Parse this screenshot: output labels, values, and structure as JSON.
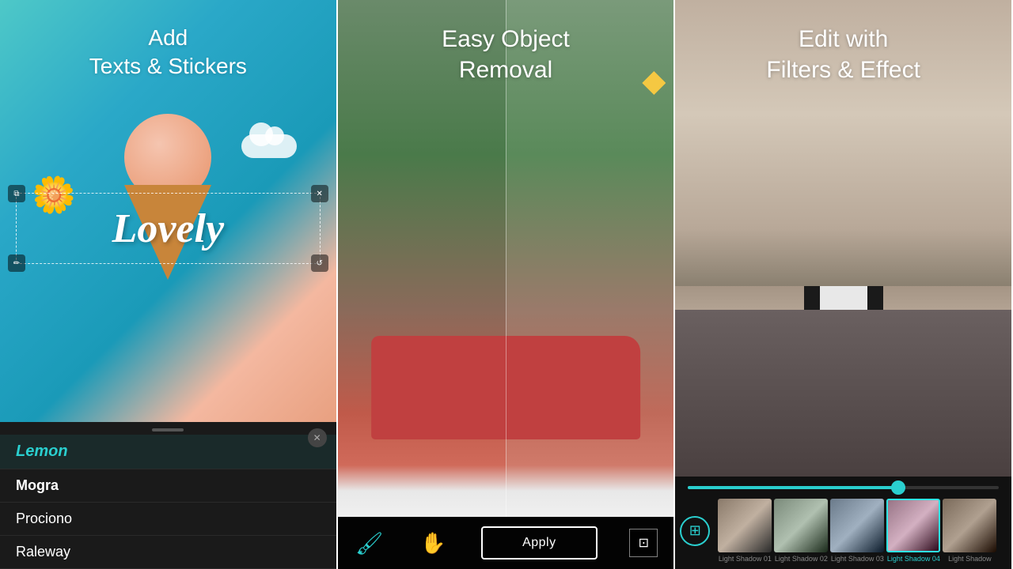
{
  "panel1": {
    "title_line1": "Add",
    "title_line2": "Texts & Stickers",
    "overlay_text": "Lovely",
    "fonts": [
      {
        "name": "Lemon",
        "active": true
      },
      {
        "name": "Mogra",
        "active": false
      },
      {
        "name": "Prociono",
        "active": false
      },
      {
        "name": "Raleway",
        "active": false
      }
    ]
  },
  "panel2": {
    "title_line1": "Easy Object",
    "title_line2": "Removal",
    "apply_button": "Apply"
  },
  "panel3": {
    "title_line1": "Edit with",
    "title_line2": "Filters & Effect",
    "filters": [
      {
        "name": "Light Shadow 01",
        "active": false
      },
      {
        "name": "Light Shadow 02",
        "active": false
      },
      {
        "name": "Light Shadow 03",
        "active": false
      },
      {
        "name": "Light Shadow 04",
        "active": true
      },
      {
        "name": "Light Shadow",
        "active": false
      }
    ],
    "slider_value": 70
  },
  "icons": {
    "copy": "⧉",
    "close": "✕",
    "edit": "✏",
    "rotate": "↺",
    "brush": "✦",
    "hand": "✋",
    "crop": "⊡",
    "settings": "⊞"
  }
}
